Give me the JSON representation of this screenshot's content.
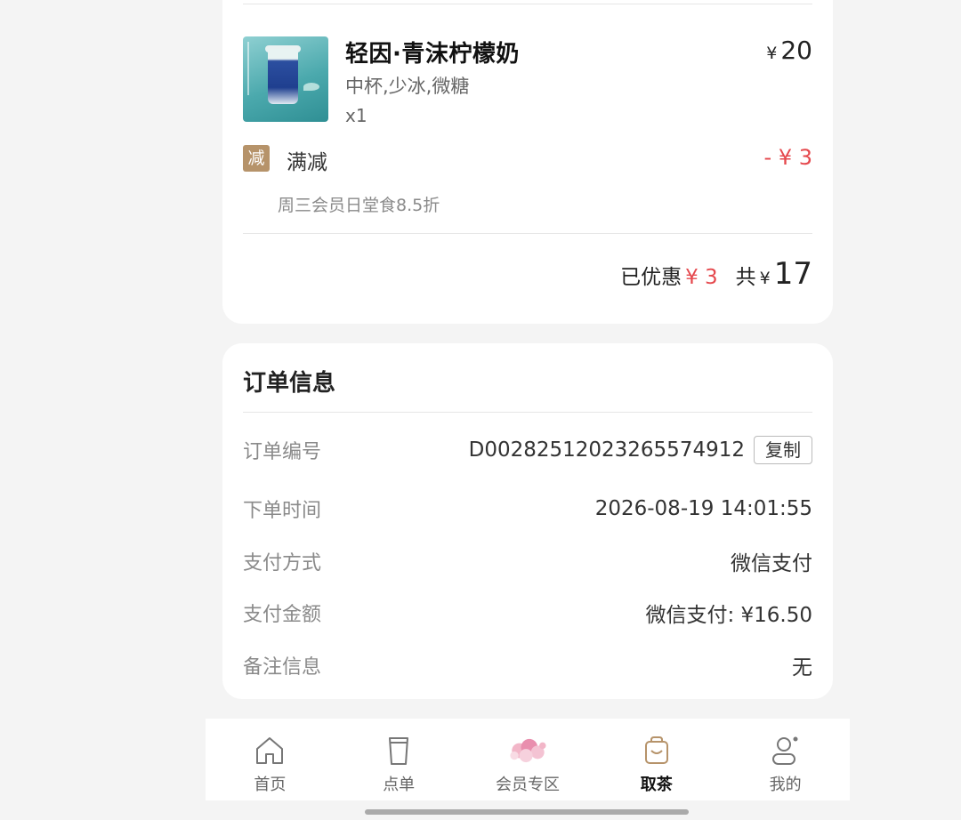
{
  "product": {
    "name": "轻因·青沫柠檬奶",
    "spec": "中杯,少冰,微糖",
    "qty": "x1",
    "price_symbol": "¥",
    "price": "20"
  },
  "promotion": {
    "badge": "减",
    "label": "满减",
    "amount": "- ¥ 3",
    "desc": "周三会员日堂食8.5折"
  },
  "summary": {
    "discount_label": "已优惠",
    "discount_value": "¥ 3",
    "total_label": "共",
    "total_symbol": "¥",
    "total": "17"
  },
  "order": {
    "title": "订单信息",
    "number_label": "订单编号",
    "number_value": "D00282512023265574912",
    "copy_label": "复制",
    "time_label": "下单时间",
    "time_value": "2026-08-19 14:01:55",
    "pay_method_label": "支付方式",
    "pay_method_value": "微信支付",
    "pay_amount_label": "支付金额",
    "pay_amount_value": "微信支付: ¥16.50",
    "remark_label": "备注信息",
    "remark_value": "无"
  },
  "tabbar": {
    "home": "首页",
    "order": "点单",
    "member": "会员专区",
    "pickup": "取茶",
    "mine": "我的"
  },
  "colors": {
    "accent_red": "#e5484d",
    "badge_gold": "#b6936a",
    "active_icon": "#b6936a"
  }
}
